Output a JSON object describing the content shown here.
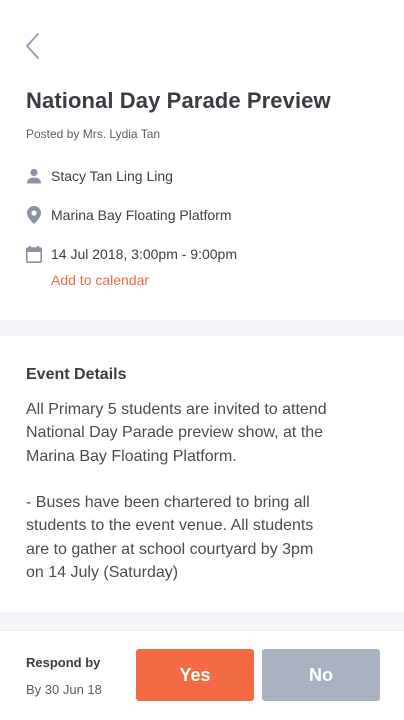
{
  "colors": {
    "accent": "#f06a45",
    "icon": "#8a92a3",
    "back_arrow": "#8fa0bc",
    "yes_button": "#f26b45",
    "no_button": "#aab2c2",
    "divider": "#f3f5f8"
  },
  "header": {
    "back_icon": "chevron-left-icon"
  },
  "event": {
    "title": "National Day Parade Preview",
    "posted_by": "Posted by Mrs. Lydia Tan",
    "person": {
      "icon": "person-icon",
      "text": "Stacy Tan Ling Ling"
    },
    "location": {
      "icon": "location-pin-icon",
      "text": "Marina Bay Floating Platform"
    },
    "datetime": {
      "icon": "calendar-icon",
      "text": "14 Jul 2018, 3:00pm - 9:00pm"
    },
    "add_to_calendar": "Add to calendar"
  },
  "details": {
    "heading": "Event Details",
    "paragraph_1": "All Primary 5 students are invited to attend\nNational Day Parade preview show, at the\nMarina Bay Floating Platform.",
    "paragraph_2": "-  Buses have been chartered to bring all\nstudents to the event venue. All students\nare to gather at school courtyard by 3pm\non 14 July (Saturday)"
  },
  "footer": {
    "respond_label": "Respond by",
    "respond_date": "By 30 Jun 18",
    "yes_label": "Yes",
    "no_label": "No"
  }
}
